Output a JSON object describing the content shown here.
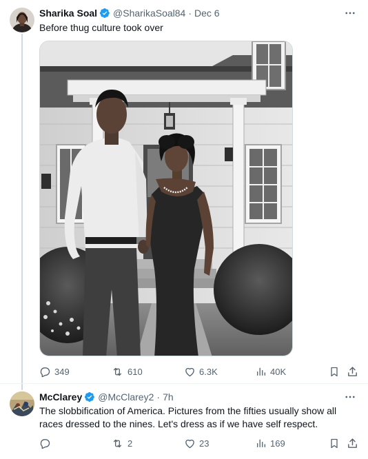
{
  "tweets": [
    {
      "name": "Sharika Soal",
      "handle": "@SharikaSoal84",
      "separator": "·",
      "time": "Dec 6",
      "text": "Before thug culture took over",
      "media_description": "Black and white photo of a couple standing in front of a white house",
      "replies": "349",
      "retweets": "610",
      "likes": "6.3K",
      "views": "40K"
    },
    {
      "name": "McClarey",
      "handle": "@McClarey2",
      "separator": "·",
      "time": "7h",
      "text": "The slobbification of America.  Pictures from the fifties usually show all races dressed to the nines.  Let's dress as if we have self respect.",
      "replies": "",
      "retweets": "2",
      "likes": "23",
      "views": "169"
    }
  ],
  "colors": {
    "text_primary": "#0f1419",
    "text_secondary": "#536471",
    "verified": "#1d9bf0",
    "divider": "#eff3f4",
    "thread_line": "#cfd9de"
  },
  "icons": [
    "verified-badge-icon",
    "more-icon",
    "reply-icon",
    "retweet-icon",
    "like-icon",
    "views-icon",
    "bookmark-icon",
    "share-icon"
  ]
}
